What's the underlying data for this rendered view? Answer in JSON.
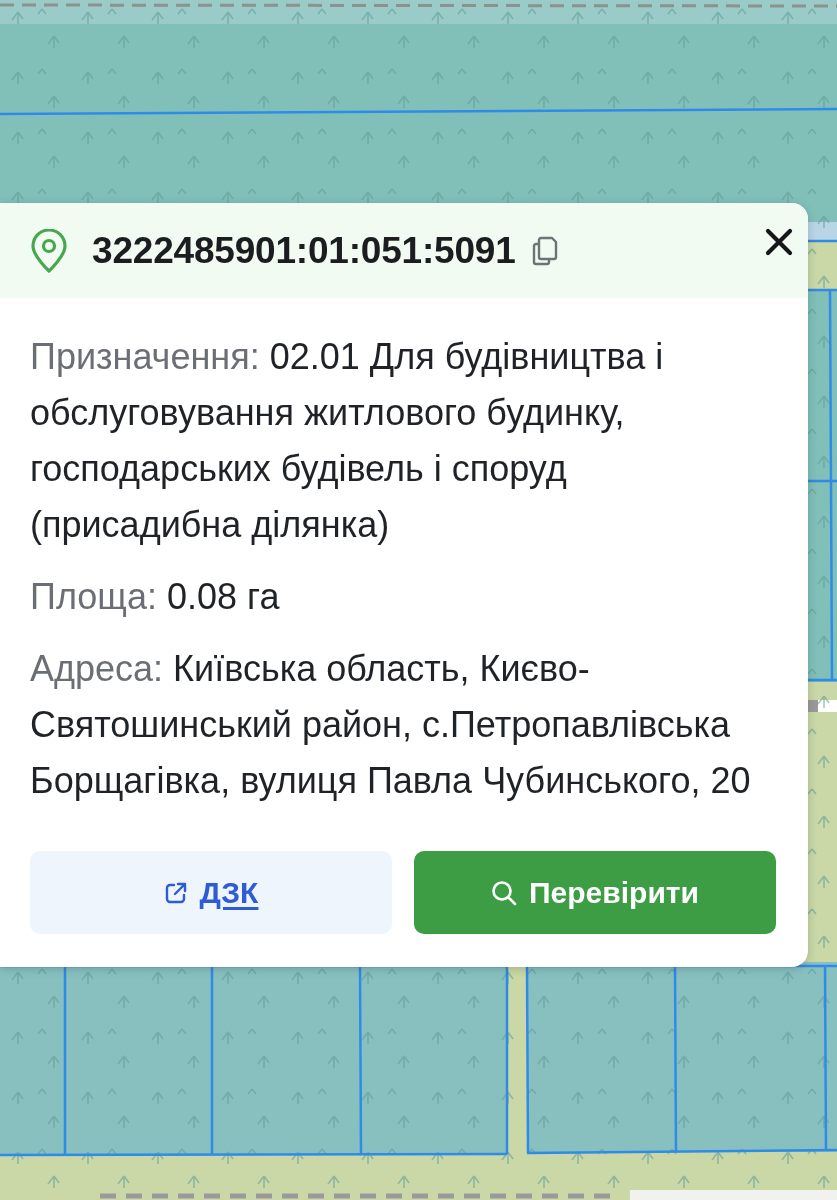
{
  "parcel_popup": {
    "cadastral_number": "3222485901:01:051:5091",
    "fields": [
      {
        "label": "Призначення:",
        "value": "02.01 Для будівництва і обслуговування житлового будинку, господарських будівель і споруд (присадибна ділянка)"
      },
      {
        "label": "Площа:",
        "value": "0.08 га"
      },
      {
        "label": "Адреса:",
        "value": "Київська область, Києво-Святошинський район, с.Петропавлівська Борщагівка, вулиця Павла Чубинського, 20"
      }
    ],
    "buttons": [
      {
        "label": "ДЗК",
        "kind": "link"
      },
      {
        "label": "Перевірити",
        "kind": "primary"
      }
    ]
  }
}
